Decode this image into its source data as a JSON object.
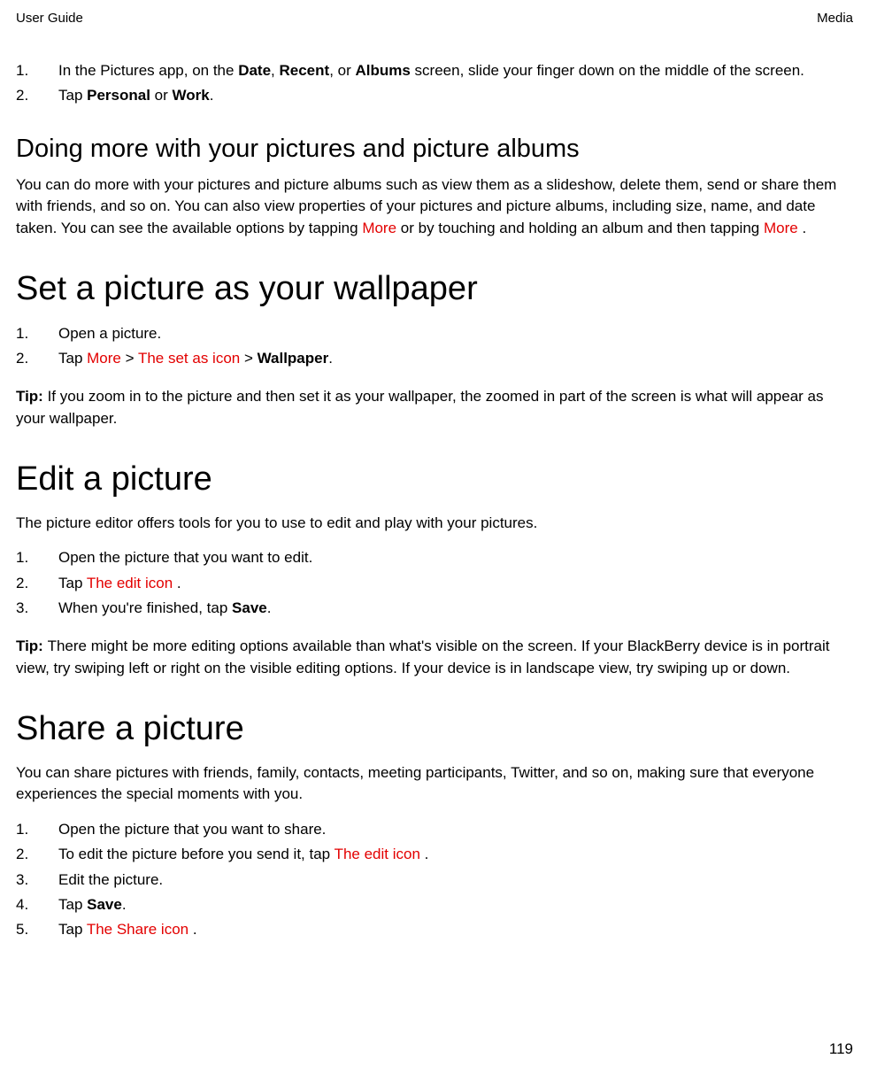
{
  "header": {
    "left": "User Guide",
    "right": "Media"
  },
  "list1": {
    "items": [
      {
        "num": "1.",
        "parts": [
          {
            "text": "In the Pictures app, on the "
          },
          {
            "text": "Date",
            "bold": true
          },
          {
            "text": ", "
          },
          {
            "text": "Recent",
            "bold": true
          },
          {
            "text": ", or "
          },
          {
            "text": "Albums",
            "bold": true
          },
          {
            "text": " screen, slide your finger down on the middle of the screen."
          }
        ]
      },
      {
        "num": "2.",
        "parts": [
          {
            "text": "Tap "
          },
          {
            "text": "Personal",
            "bold": true
          },
          {
            "text": " or "
          },
          {
            "text": "Work",
            "bold": true
          },
          {
            "text": "."
          }
        ]
      }
    ]
  },
  "h2_1": "Doing more with your pictures and picture albums",
  "para1_parts": [
    {
      "text": "You can do more with your pictures and picture albums such as view them as a slideshow, delete them, send or share them with friends, and so on. You can also view properties of your pictures and picture albums, including size, name, and date taken. You can see the available options by tapping  "
    },
    {
      "text": "More",
      "red": true
    },
    {
      "text": "  or by touching and holding an album and then tapping  "
    },
    {
      "text": "More",
      "red": true
    },
    {
      "text": " ."
    }
  ],
  "h1_1": "Set a picture as your wallpaper",
  "list2": {
    "items": [
      {
        "num": "1.",
        "parts": [
          {
            "text": "Open a picture."
          }
        ]
      },
      {
        "num": "2.",
        "parts": [
          {
            "text": "Tap  "
          },
          {
            "text": "More",
            "red": true
          },
          {
            "text": "  >  "
          },
          {
            "text": "The set as icon",
            "red": true
          },
          {
            "text": "  > "
          },
          {
            "text": "Wallpaper",
            "bold": true
          },
          {
            "text": "."
          }
        ]
      }
    ]
  },
  "tip1_parts": [
    {
      "text": "Tip: ",
      "bold": true
    },
    {
      "text": "If you zoom in to the picture and then set it as your wallpaper, the zoomed in part of the screen is what will appear as your wallpaper."
    }
  ],
  "h1_2": "Edit a picture",
  "para2": "The picture editor offers tools for you to use to edit and play with your pictures.",
  "list3": {
    "items": [
      {
        "num": "1.",
        "parts": [
          {
            "text": "Open the picture that you want to edit."
          }
        ]
      },
      {
        "num": "2.",
        "parts": [
          {
            "text": "Tap  "
          },
          {
            "text": "The edit icon",
            "red": true
          },
          {
            "text": " ."
          }
        ]
      },
      {
        "num": "3.",
        "parts": [
          {
            "text": "When you're finished, tap "
          },
          {
            "text": "Save",
            "bold": true
          },
          {
            "text": "."
          }
        ]
      }
    ]
  },
  "tip2_parts": [
    {
      "text": "Tip: ",
      "bold": true
    },
    {
      "text": "There might be more editing options available than what's visible on the screen. If your BlackBerry device is in portrait view, try swiping left or right on the visible editing options. If your device is in landscape view, try swiping up or down."
    }
  ],
  "h1_3": "Share a picture",
  "para3": "You can share pictures with friends, family, contacts, meeting participants, Twitter, and so on, making sure that everyone experiences the special moments with you.",
  "list4": {
    "items": [
      {
        "num": "1.",
        "parts": [
          {
            "text": "Open the picture that you want to share."
          }
        ]
      },
      {
        "num": "2.",
        "parts": [
          {
            "text": "To edit the picture before you send it, tap  "
          },
          {
            "text": "The edit icon",
            "red": true
          },
          {
            "text": " ."
          }
        ]
      },
      {
        "num": "3.",
        "parts": [
          {
            "text": "Edit the picture."
          }
        ]
      },
      {
        "num": "4.",
        "parts": [
          {
            "text": "Tap "
          },
          {
            "text": "Save",
            "bold": true
          },
          {
            "text": "."
          }
        ]
      },
      {
        "num": "5.",
        "parts": [
          {
            "text": "Tap "
          },
          {
            "text": "The Share icon",
            "red": true
          },
          {
            "text": " ."
          }
        ]
      }
    ]
  },
  "page_number": "119"
}
